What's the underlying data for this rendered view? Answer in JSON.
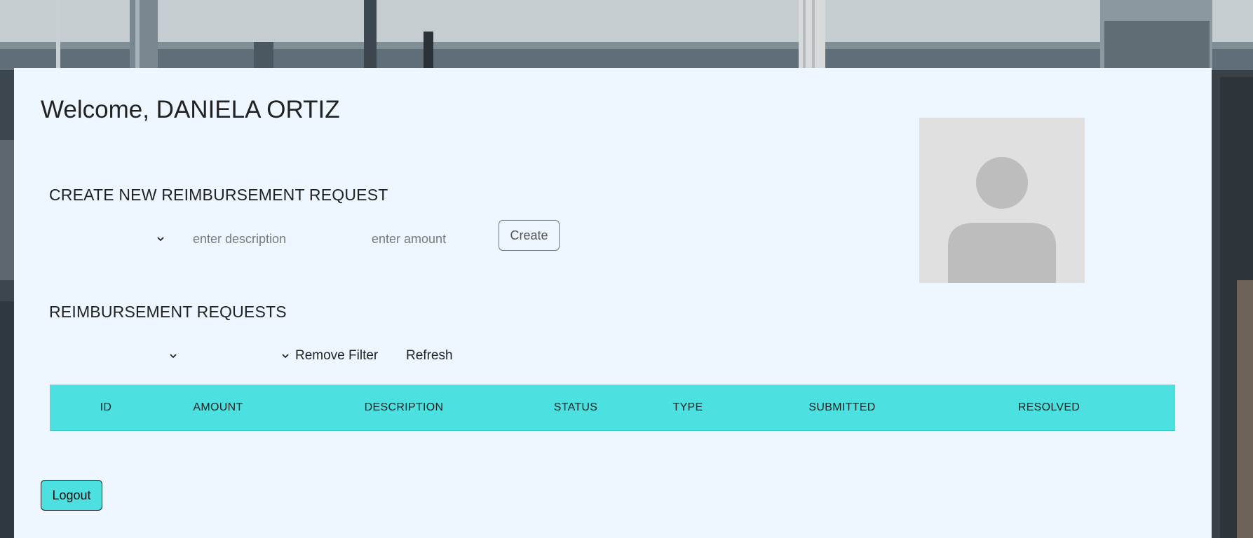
{
  "greeting": "Welcome, DANIELA ORTIZ",
  "create_section": {
    "title": "CREATE NEW REIMBURSEMENT REQUEST",
    "type_select_value": "",
    "description_placeholder": "enter description",
    "amount_placeholder": "enter amount",
    "create_label": "Create"
  },
  "requests_section": {
    "title": "REIMBURSEMENT REQUESTS",
    "status_filter_value": "",
    "type_filter_value": "",
    "remove_filter_label": "Remove Filter",
    "refresh_label": "Refresh",
    "columns": [
      "ID",
      "AMOUNT",
      "DESCRIPTION",
      "STATUS",
      "TYPE",
      "SUBMITTED",
      "RESOLVED"
    ],
    "rows": []
  },
  "logout_label": "Logout",
  "colors": {
    "accent": "#4de0e0",
    "panel": "#eef7ff",
    "avatar_bg": "#e0e0e0",
    "avatar_fg": "#bdbdbd"
  },
  "icons": {
    "select_chevron": "chevron-down-icon",
    "avatar": "user-placeholder-icon"
  }
}
